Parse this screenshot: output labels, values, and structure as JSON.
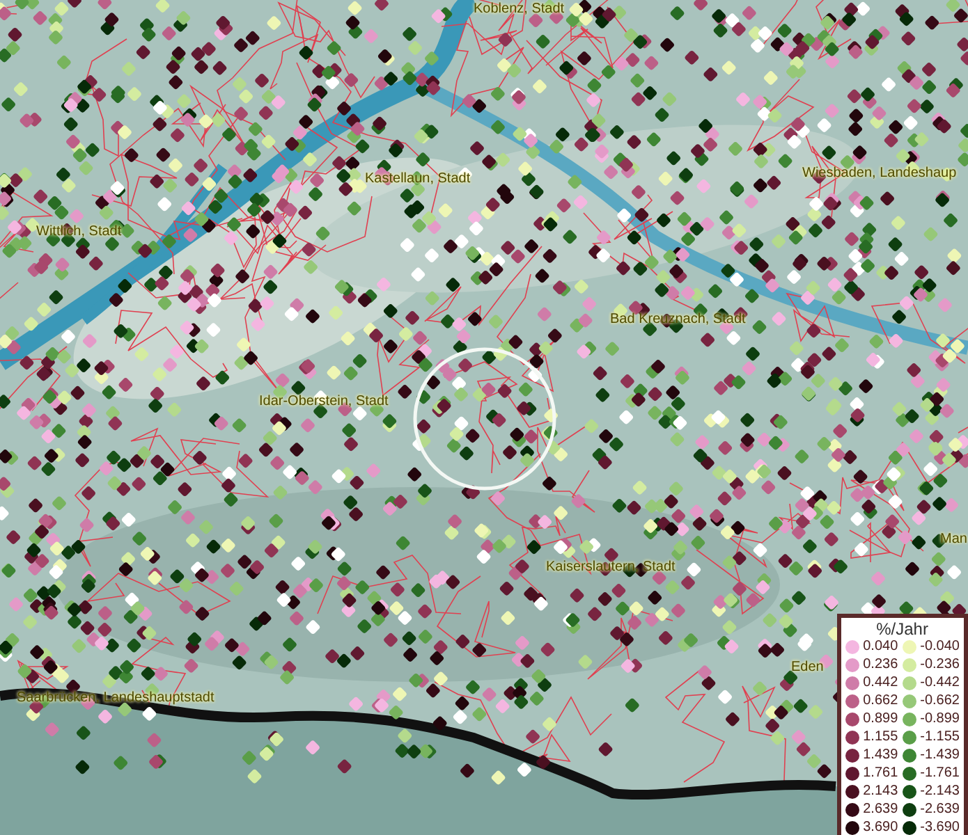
{
  "map": {
    "place_labels": [
      "Koblenz, Stadt",
      "Kastellaun, Stadt",
      "Wiesbaden, Landeshaup",
      "Wittlich, Stadt",
      "Bad Kreuznach, Stadt",
      "Idar-Oberstein, Stadt",
      "Man",
      "Kaiserslautern, Stadt",
      "Eden",
      "Saarbrücken, Landeshauptstadt"
    ]
  },
  "legend": {
    "title": "%/Jahr",
    "rows": [
      {
        "left": {
          "label": "0.040",
          "color": "#f4b6e0"
        },
        "right": {
          "label": "-0.040",
          "color": "#eef6b4"
        }
      },
      {
        "left": {
          "label": "0.236",
          "color": "#e49ac8"
        },
        "right": {
          "label": "-0.236",
          "color": "#d4eca0"
        }
      },
      {
        "left": {
          "label": "0.442",
          "color": "#cf7ca8"
        },
        "right": {
          "label": "-0.442",
          "color": "#b4da8c"
        }
      },
      {
        "left": {
          "label": "0.662",
          "color": "#bc6088"
        },
        "right": {
          "label": "-0.662",
          "color": "#96c878"
        }
      },
      {
        "left": {
          "label": "0.899",
          "color": "#a8486c"
        },
        "right": {
          "label": "-0.899",
          "color": "#78b45e"
        }
      },
      {
        "left": {
          "label": "1.155",
          "color": "#903454"
        },
        "right": {
          "label": "-1.155",
          "color": "#5a9e48"
        }
      },
      {
        "left": {
          "label": "1.439",
          "color": "#782440"
        },
        "right": {
          "label": "-1.439",
          "color": "#3e8634"
        }
      },
      {
        "left": {
          "label": "1.761",
          "color": "#601830"
        },
        "right": {
          "label": "-1.761",
          "color": "#286c24"
        }
      },
      {
        "left": {
          "label": "2.143",
          "color": "#4a1020"
        },
        "right": {
          "label": "-2.143",
          "color": "#185418"
        }
      },
      {
        "left": {
          "label": "2.639",
          "color": "#360a16"
        },
        "right": {
          "label": "-2.639",
          "color": "#0e3e10"
        }
      },
      {
        "left": {
          "label": "3.690",
          "color": "#22060c"
        },
        "right": {
          "label": "-3.690",
          "color": "#062a08"
        }
      }
    ]
  }
}
